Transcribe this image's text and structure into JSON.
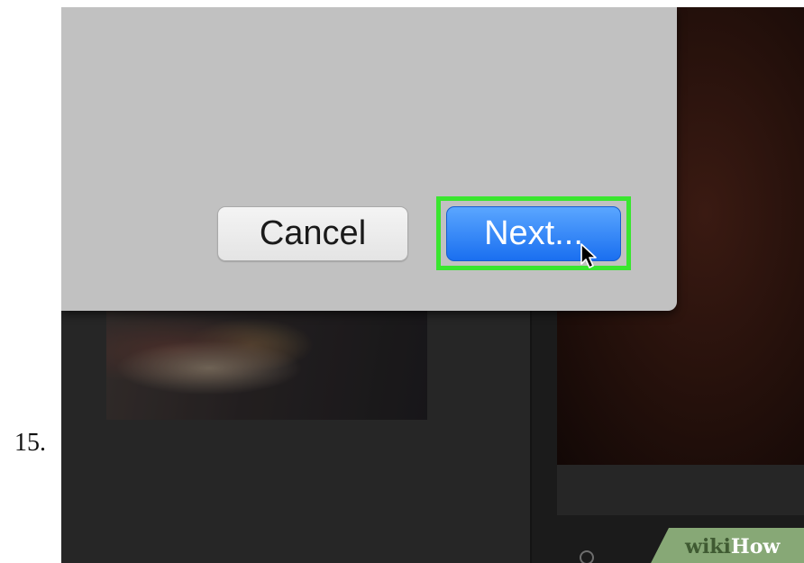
{
  "step": {
    "number": "15."
  },
  "dialog": {
    "cancel_label": "Cancel",
    "next_label": "Next...",
    "highlight_color": "#39e62f",
    "primary_color": "#1a6ff0"
  },
  "background_app": {
    "icons": [
      "mouse-pointer-icon",
      "playback-control-icon"
    ]
  },
  "watermark": {
    "part1": "wiki",
    "part2": "How",
    "color": "#87a876"
  }
}
